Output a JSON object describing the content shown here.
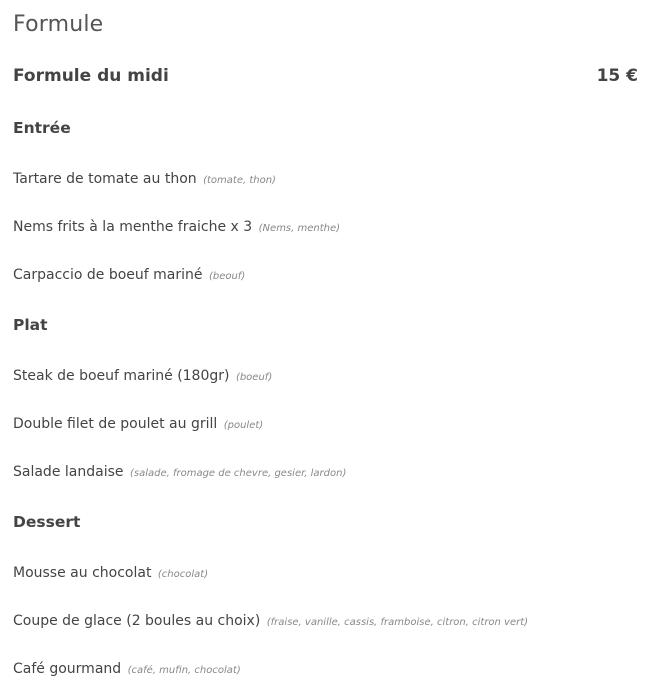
{
  "section_title": "Formule",
  "formula": {
    "name": "Formule du midi",
    "price": "15 €"
  },
  "courses": [
    {
      "title": "Entrée",
      "dishes": [
        {
          "name": "Tartare de tomate au thon",
          "ingredients": "(tomate, thon)"
        },
        {
          "name": "Nems frits à la menthe fraiche x 3",
          "ingredients": "(Nems, menthe)"
        },
        {
          "name": "Carpaccio de boeuf mariné",
          "ingredients": "(beouf)"
        }
      ]
    },
    {
      "title": "Plat",
      "dishes": [
        {
          "name": "Steak de boeuf mariné (180gr)",
          "ingredients": "(boeuf)"
        },
        {
          "name": "Double filet de poulet au grill",
          "ingredients": "(poulet)"
        },
        {
          "name": "Salade landaise",
          "ingredients": "(salade, fromage de chevre, gesier, lardon)"
        }
      ]
    },
    {
      "title": "Dessert",
      "dishes": [
        {
          "name": "Mousse au chocolat",
          "ingredients": "(chocolat)"
        },
        {
          "name": "Coupe de glace (2 boules au choix)",
          "ingredients": "(fraise, vanille, cassis, framboise, citron, citron vert)"
        },
        {
          "name": "Café gourmand",
          "ingredients": "(café, mufin, chocolat)"
        }
      ]
    }
  ]
}
